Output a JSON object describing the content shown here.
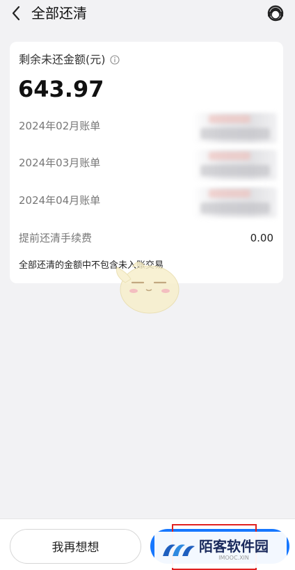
{
  "header": {
    "title": "全部还清"
  },
  "summary": {
    "remaining_label": "剩余未还金额(元)",
    "amount": "643.97"
  },
  "bills": [
    {
      "label": "2024年02月账单"
    },
    {
      "label": "2024年03月账单"
    },
    {
      "label": "2024年04月账单"
    }
  ],
  "fee": {
    "label": "提前还清手续费",
    "value": "0.00"
  },
  "note": "全部还清的金额中不包含未入账交易",
  "actions": {
    "secondary_label": "我再想想"
  },
  "watermark": {
    "name": "陌客软件园",
    "domain": "IMOOC.XIN"
  },
  "colors": {
    "primary": "#1677ff",
    "background": "#f2f2f4",
    "highlight": "#e02020"
  }
}
